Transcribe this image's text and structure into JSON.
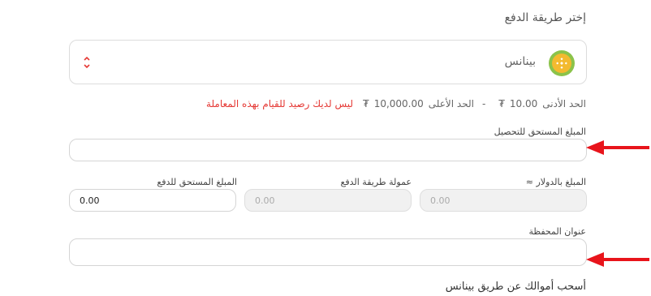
{
  "section": {
    "title": "إختر طريقة الدفع"
  },
  "payment_method": {
    "selected": "بينانس",
    "icon": "binance-coin-icon",
    "accent": "#f3ba2f"
  },
  "limits": {
    "min_label": "الحد الأدنى",
    "min_value": "10.00",
    "currency": "₮",
    "separator": "-",
    "max_label": "الحد الأعلى",
    "max_value": "10,000.00",
    "warning": "ليس لديك رصيد للقيام بهذه المعاملة",
    "warning_color": "#e53935"
  },
  "fields": {
    "amount_due_collect": {
      "label": "المبلغ المستحق للتحصيل",
      "value": ""
    },
    "amount_usd": {
      "label": "المبلغ بالدولار ≈",
      "value": "0.00"
    },
    "method_fee": {
      "label": "عمولة طريقة الدفع",
      "value": "0.00"
    },
    "amount_due_pay": {
      "label": "المبلغ المستحق للدفع",
      "value": "0.00"
    },
    "wallet_address": {
      "label": "عنوان المحفظة",
      "value": ""
    }
  },
  "footer": {
    "text": "أسحب أموالك عن طريق بينانس"
  },
  "annotation": {
    "arrow_color": "#e8141b"
  }
}
